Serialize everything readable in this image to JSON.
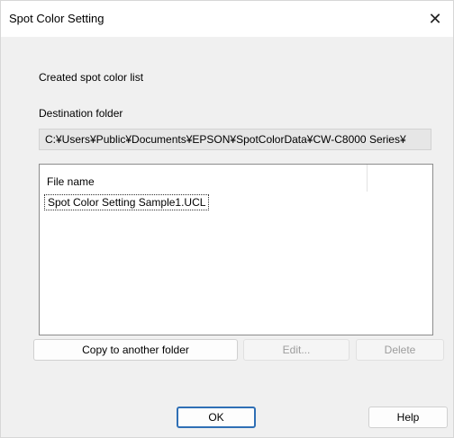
{
  "window": {
    "title": "Spot Color Setting",
    "close_symbol": "✕"
  },
  "created_list_label": "Created spot color list",
  "destination": {
    "label": "Destination folder",
    "path": "C:¥Users¥Public¥Documents¥EPSON¥SpotColorData¥CW-C8000 Series¥"
  },
  "file_list": {
    "column_header": "File name",
    "items": [
      "Spot Color Setting Sample1.UCL"
    ]
  },
  "buttons": {
    "copy": "Copy to another folder",
    "edit": "Edit...",
    "delete": "Delete",
    "ok": "OK",
    "help": "Help"
  }
}
